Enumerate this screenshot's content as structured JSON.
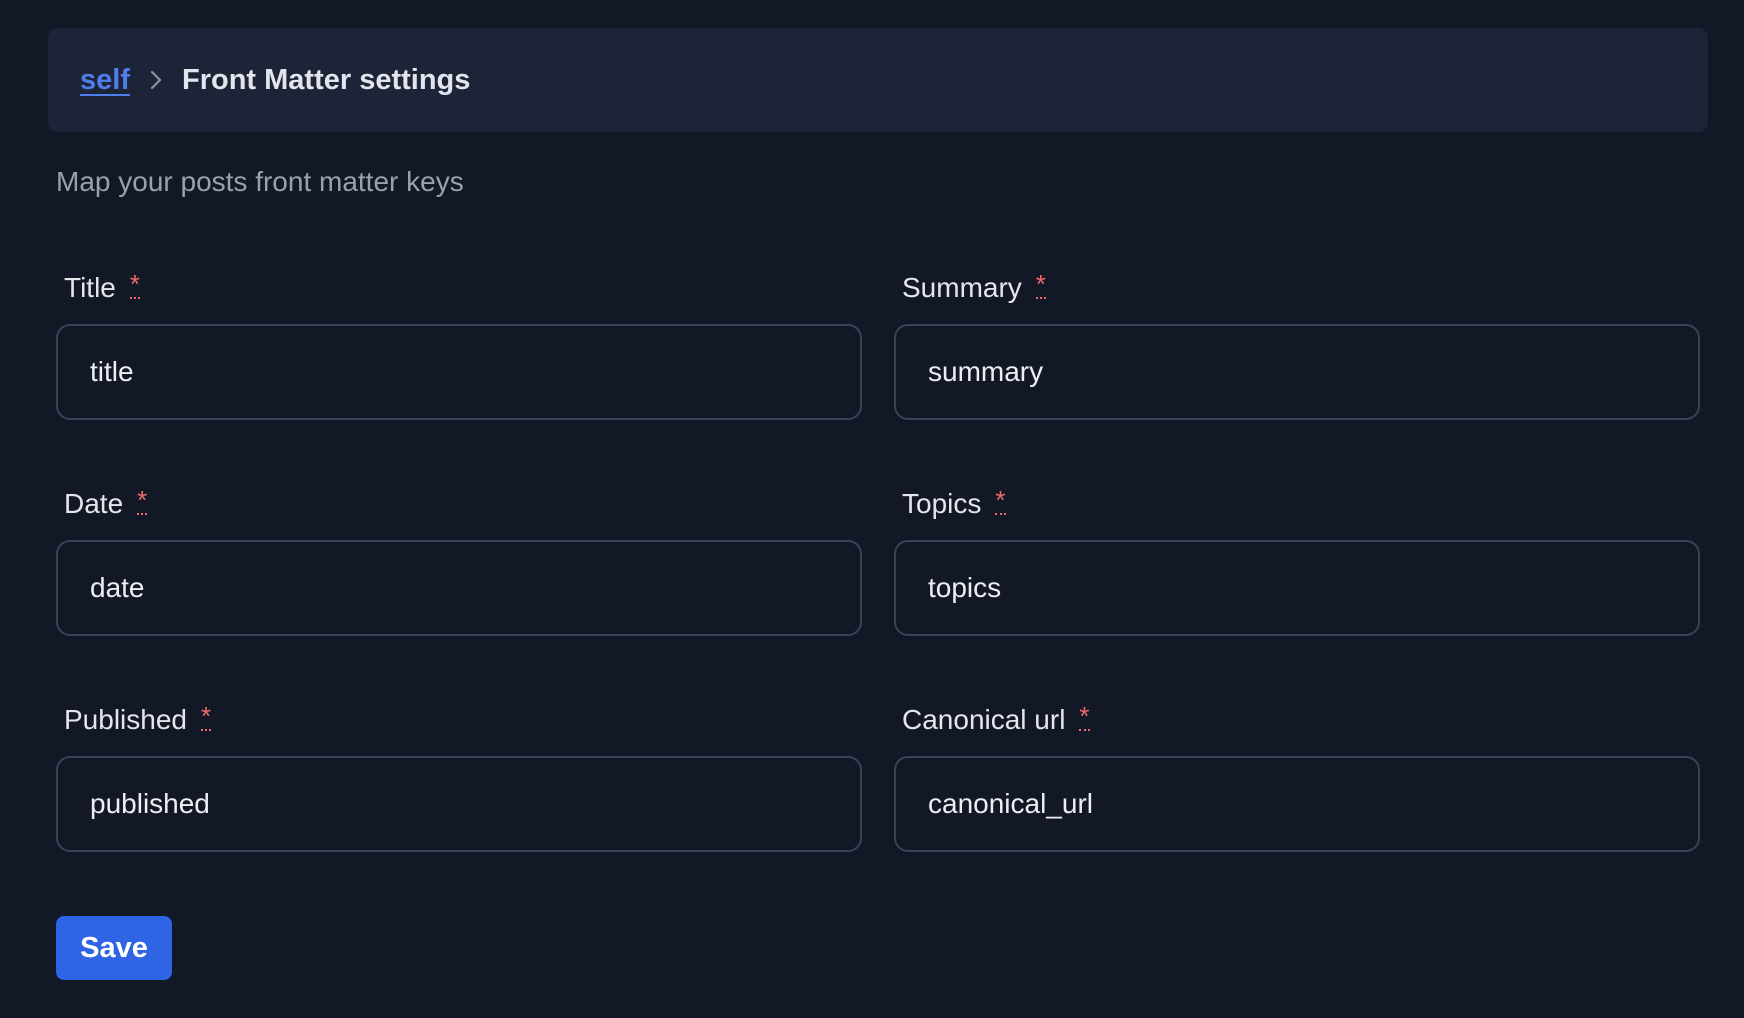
{
  "breadcrumb": {
    "parent_label": "self",
    "current_label": "Front Matter settings"
  },
  "description": "Map your posts front matter keys",
  "required_marker": "*",
  "fields": [
    {
      "label": "Title",
      "value": "title"
    },
    {
      "label": "Summary",
      "value": "summary"
    },
    {
      "label": "Date",
      "value": "date"
    },
    {
      "label": "Topics",
      "value": "topics"
    },
    {
      "label": "Published",
      "value": "published"
    },
    {
      "label": "Canonical url",
      "value": "canonical_url"
    }
  ],
  "save_button": {
    "label": "Save"
  },
  "colors": {
    "background": "#131827",
    "panel": "#1d2438",
    "link": "#4f7dea",
    "required": "#f06a6a",
    "primary": "#2f64e4"
  },
  "icons": {
    "breadcrumb_separator": "chevron-right-icon"
  }
}
